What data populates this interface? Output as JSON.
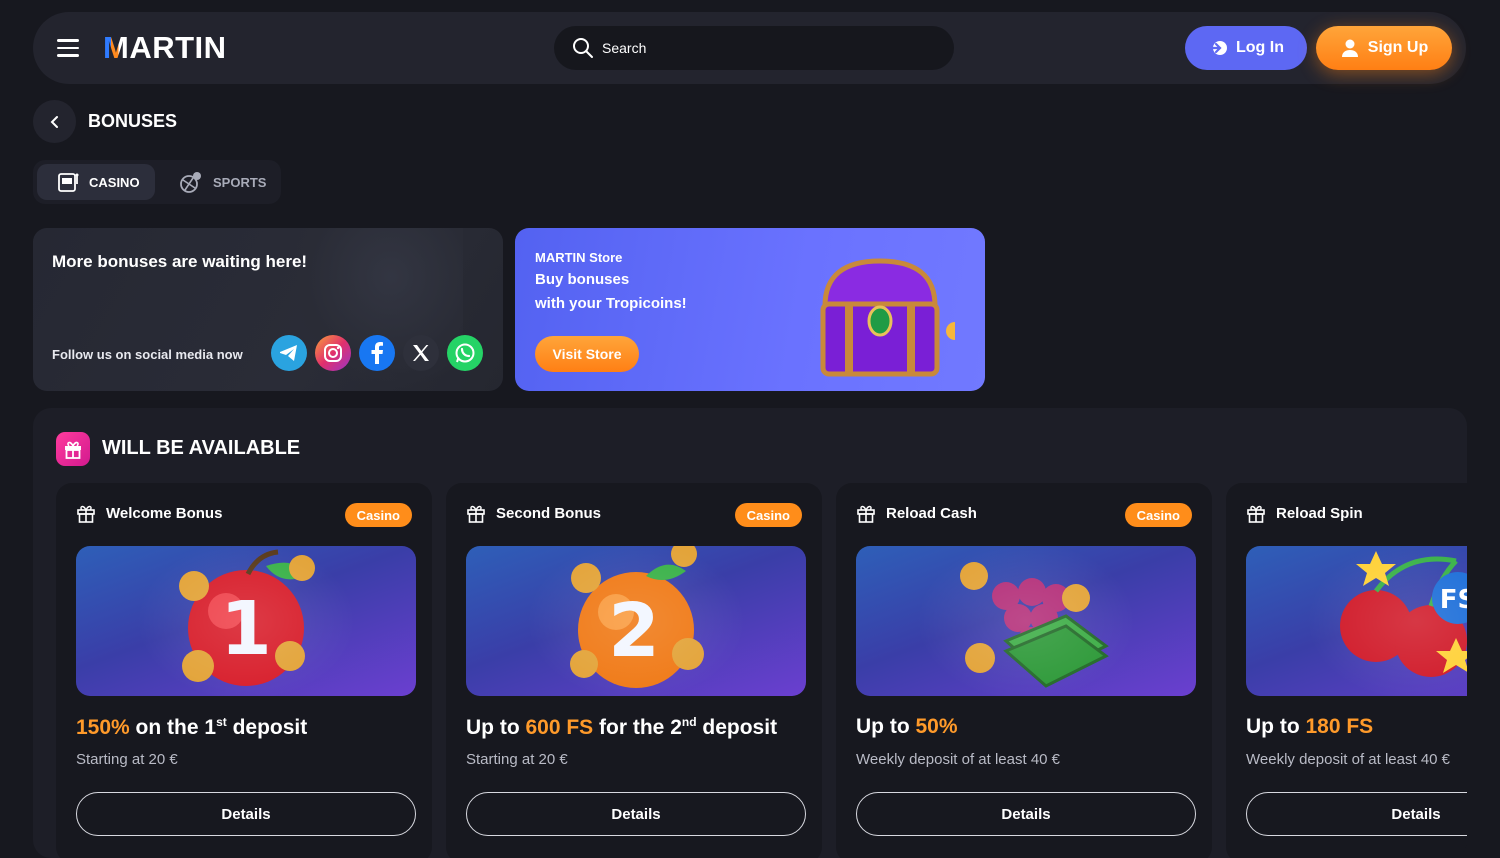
{
  "header": {
    "logo": "MARTIN",
    "search_placeholder": "Search",
    "login_label": "Log In",
    "signup_label": "Sign Up"
  },
  "page": {
    "title": "BONUSES"
  },
  "tabs": [
    {
      "label": "CASINO",
      "active": true,
      "icon": "slot-machine-icon"
    },
    {
      "label": "SPORTS",
      "active": false,
      "icon": "sports-ball-icon"
    }
  ],
  "promo_social": {
    "title": "More bonuses are waiting here!",
    "follow_text": "Follow us on social media now",
    "networks": [
      "telegram",
      "instagram",
      "facebook",
      "x",
      "whatsapp"
    ]
  },
  "promo_store": {
    "store_name": "MARTIN Store",
    "line1": "Buy bonuses",
    "line2": "with your Tropicoins!",
    "button": "Visit Store"
  },
  "section": {
    "title": "WILL BE AVAILABLE"
  },
  "cards": [
    {
      "title": "Welcome Bonus",
      "badge": "Casino",
      "main_pre": "",
      "main_hl": "150%",
      "main_post": " on the 1",
      "sup": "st",
      "main_tail": " deposit",
      "sub": "Starting at 20 €",
      "button": "Details",
      "art": "apple-1"
    },
    {
      "title": "Second Bonus",
      "badge": "Casino",
      "main_pre": "Up to ",
      "main_hl": "600 FS",
      "main_post": " for the 2",
      "sup": "nd",
      "main_tail": " deposit",
      "sub": "Starting at 20 €",
      "button": "Details",
      "art": "orange-2"
    },
    {
      "title": "Reload Cash",
      "badge": "Casino",
      "main_pre": "Up to ",
      "main_hl": "50%",
      "main_post": "",
      "sup": "",
      "main_tail": "",
      "sub": "Weekly deposit of at least 40 €",
      "button": "Details",
      "art": "grapes-cash"
    },
    {
      "title": "Reload Spin",
      "badge": "",
      "main_pre": "Up to ",
      "main_hl": "180 FS",
      "main_post": "",
      "sup": "",
      "main_tail": "",
      "sub": "Weekly deposit of at least 40 €",
      "button": "Details",
      "art": "cherries-fs"
    }
  ],
  "colors": {
    "accent_orange": "#ff8d1a",
    "accent_blue": "#5d68f3",
    "bg": "#17181f",
    "panel": "#1d1e27"
  }
}
